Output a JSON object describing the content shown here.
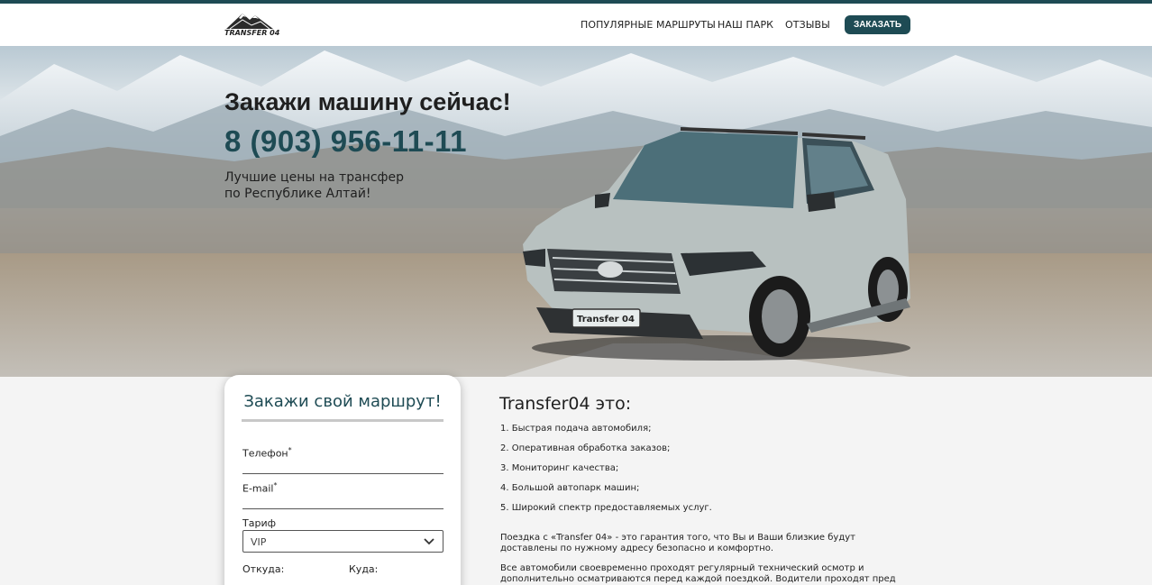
{
  "header": {
    "logo_text": "TRANSFER 04",
    "nav": [
      "ПОПУЛЯРНЫЕ МАРШРУТЫ",
      "НАШ ПАРК",
      "ОТЗЫВЫ"
    ],
    "order_button": "ЗАКАЗАТЬ"
  },
  "hero": {
    "title": "Закажи машину сейчас!",
    "phone": "8 (903) 956-11-11",
    "subtitle_line1": "Лучшие цены на трансфер",
    "subtitle_line2": "по Республике Алтай!",
    "plate_text": "Transfer 04"
  },
  "form": {
    "title": "Закажи свой маршрут!",
    "phone_label": "Телефон",
    "email_label": "E-mail",
    "required_mark": "*",
    "tariff_label": "Тариф",
    "tariff_value": "VIP",
    "from_label": "Откуда:",
    "to_label": "Куда:"
  },
  "info": {
    "title": "Transfer04 это:",
    "items": [
      "1. Быстрая подача автомобиля;",
      "2. Оперативная обработка заказов;",
      "3. Мониторинг качества;",
      "4. Большой автопарк машин;",
      "5. Широкий спектр предоставляемых услуг."
    ],
    "para1": "Поездка с «Transfer 04» - это гарантия того, что Вы и Ваши близкие будут доставлены по нужному адресу безопасно и комфортно.",
    "para2": "Все автомобили своевременно проходят регулярный технический осмотр и дополнительно осматриваются перед каждой поездкой. Водители проходят пред"
  },
  "colors": {
    "accent": "#1e4b54",
    "background": "#f4f4f4"
  }
}
